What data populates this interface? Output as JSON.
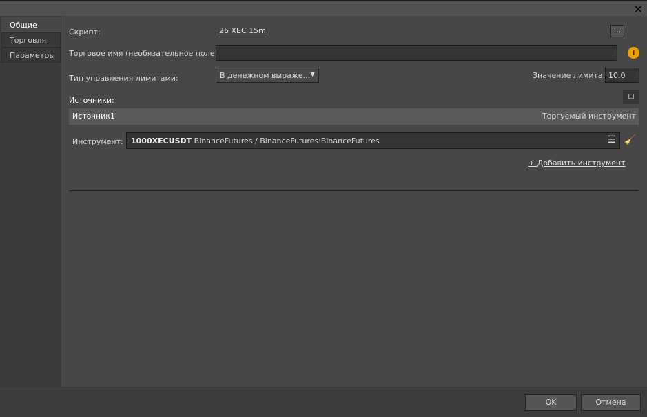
{
  "tabs": [
    "Общие",
    "Торговля",
    "Параметры"
  ],
  "script": {
    "label": "Скрипт:",
    "value": "26 XEC 15m",
    "browse": "..."
  },
  "trade_name": {
    "label": "Торговое имя (необязательное поле):",
    "value": ""
  },
  "limit_type": {
    "label": "Тип управления лимитами:",
    "value": "В денежном выраже..."
  },
  "limit_value": {
    "label": "Значение лимита:",
    "value": "10.0"
  },
  "sources": {
    "label": "Источники:",
    "header_name": "Источник1",
    "header_right": "Торгуемый инструмент",
    "instrument_label": "Инструмент:",
    "instrument_symbol": "1000XECUSDT",
    "instrument_rest": " BinanceFutures / BinanceFutures:BinanceFutures",
    "add": "+ Добавить инструмент"
  },
  "footer": {
    "ok": "OK",
    "cancel": "Отмена"
  },
  "colors": {
    "info": "#f0a000"
  }
}
